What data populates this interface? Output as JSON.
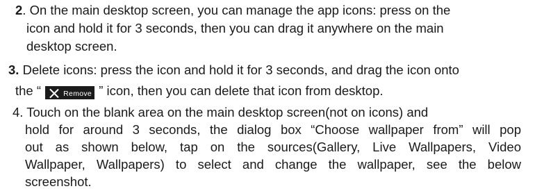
{
  "items": [
    {
      "number": "2",
      "lines": [
        ". On the main desktop screen, you can manage the app icons: press on the",
        "icon and hold it for 3 seconds, then you can drag it anywhere on the main",
        "desktop screen."
      ]
    },
    {
      "number": "3.",
      "first_line": " Delete icons: press the icon and hold it for 3 seconds, and drag the icon onto",
      "second_line_before": "the “ ",
      "remove_chip_label": "Remove",
      "second_line_after": " ” icon, then you can delete that icon from desktop."
    },
    {
      "lines": [
        "4. Touch on the blank area on the main desktop screen(not on icons) and",
        "hold for around 3 seconds, the dialog box “Choose wallpaper from” will pop",
        "out as shown below, tap on the sources(Gallery, Live Wallpapers, Video",
        "Wallpaper, Wallpapers) to select and change the wallpaper, see the below",
        "screenshot."
      ]
    }
  ]
}
